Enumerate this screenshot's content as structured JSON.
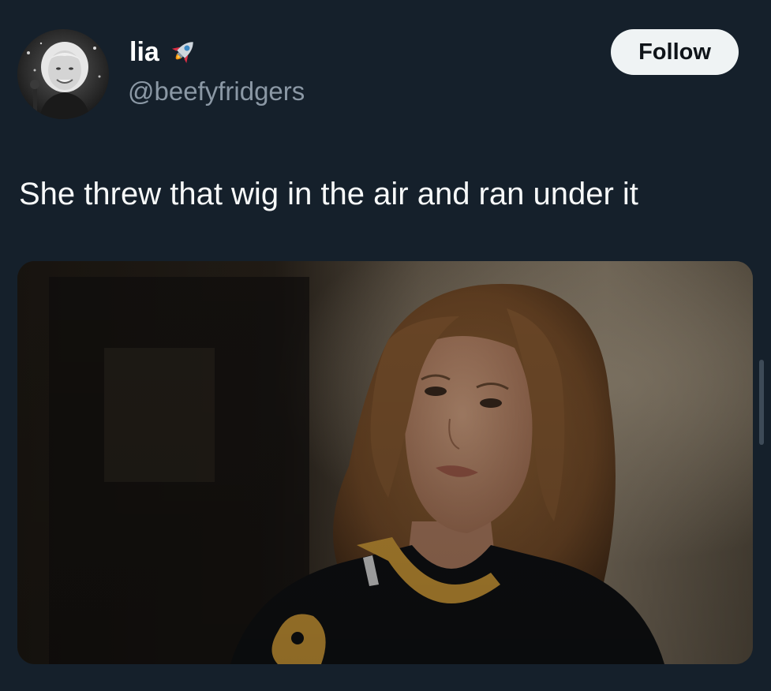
{
  "tweet": {
    "display_name": "lia",
    "name_emoji": "rocket-icon",
    "handle": "@beefyfridgers",
    "follow_label": "Follow",
    "text": "She threw that wig in the air and ran under it",
    "avatar": "avatar",
    "media": "tweet-photo"
  },
  "colors": {
    "background": "#15202b",
    "text": "#f7f9f9",
    "secondary_text": "#8b98a5",
    "follow_bg": "#eff3f4",
    "follow_text": "#0f1419"
  }
}
